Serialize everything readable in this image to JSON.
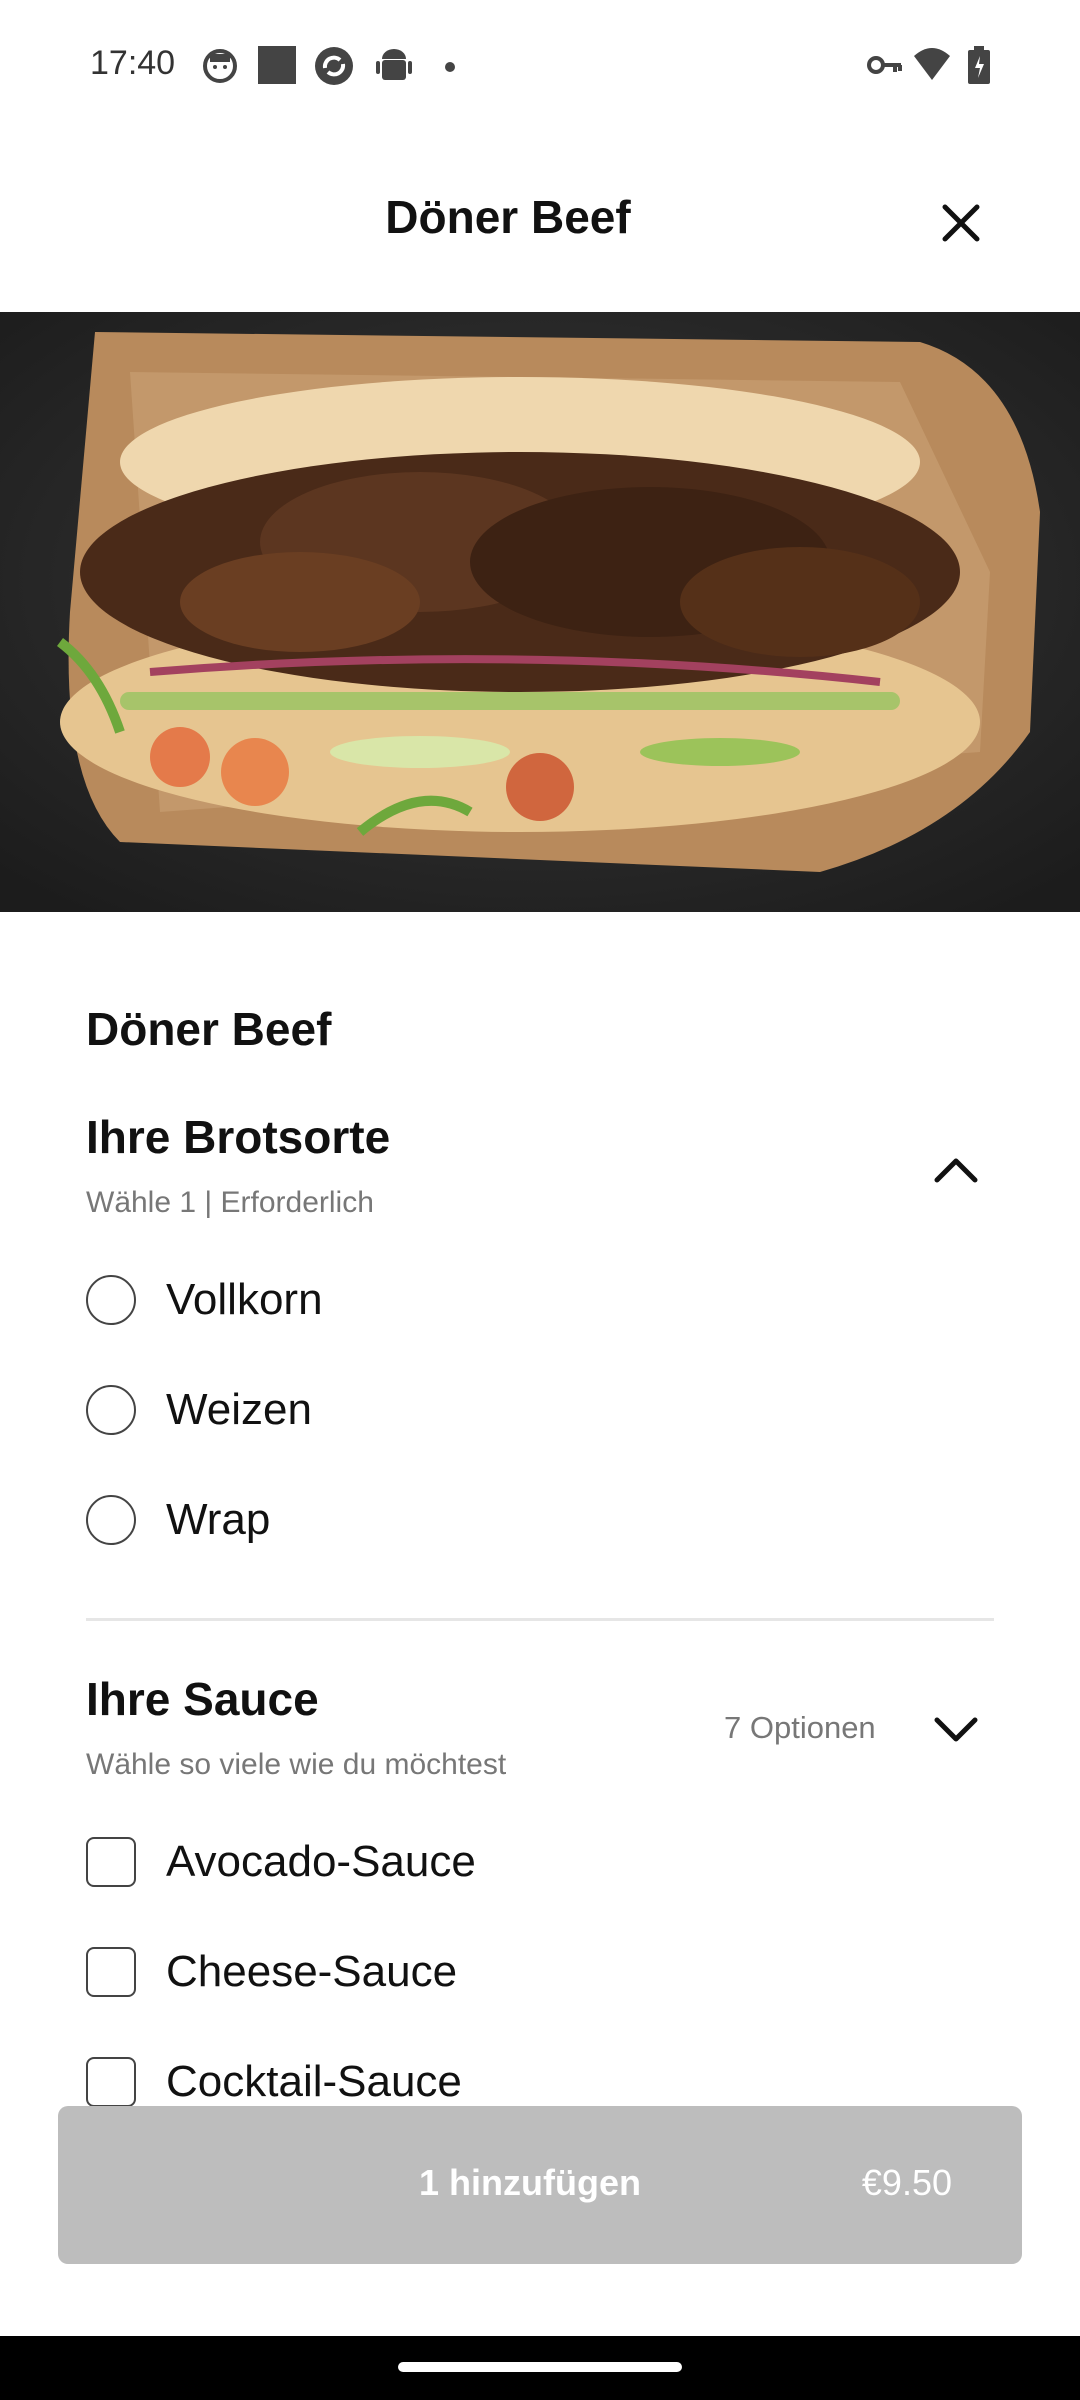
{
  "status_bar": {
    "time": "17:40",
    "icons": [
      "face-icon",
      "square-icon",
      "sync-icon",
      "android-icon",
      "dot-icon",
      "key-icon",
      "wifi-icon",
      "battery-charging-icon"
    ]
  },
  "header": {
    "title": "Döner Beef",
    "close_icon": "close-icon"
  },
  "hero": {
    "image": "doner-sandwich-image"
  },
  "product": {
    "name": "Döner Beef"
  },
  "bread_section": {
    "title": "Ihre Brotsorte",
    "subtitle": "Wähle 1  |  Erforderlich",
    "expanded": true,
    "options": [
      "Vollkorn",
      "Weizen",
      "Wrap"
    ]
  },
  "sauce_section": {
    "title": "Ihre Sauce",
    "subtitle": "Wähle so viele wie du möchtest",
    "count_label": "7 Optionen",
    "expanded": false,
    "options": [
      "Avocado-Sauce",
      "Cheese-Sauce",
      "Cocktail-Sauce"
    ]
  },
  "footer": {
    "add_label": "1 hinzufügen",
    "price": "€9.50",
    "button_color": "#bdbdbd"
  }
}
